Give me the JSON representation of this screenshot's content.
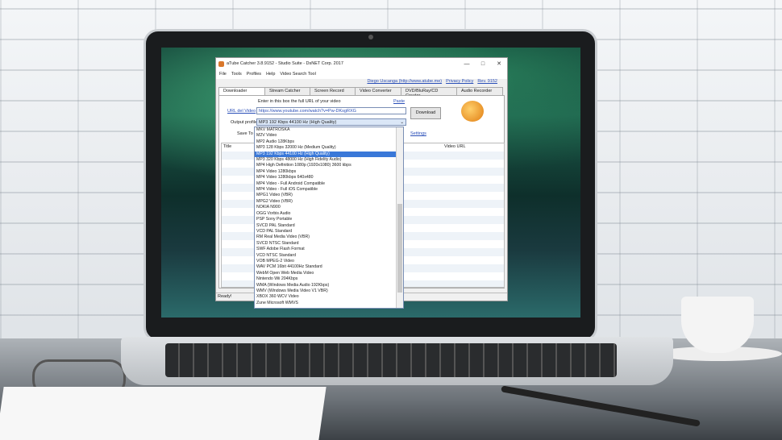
{
  "window": {
    "title": "aTube Catcher 3.8.9152 - Studio Suite - DsNET Corp. 2017",
    "minimize": "—",
    "maximize": "□",
    "close": "✕"
  },
  "menu": [
    "File",
    "Tools",
    "Profiles",
    "Help",
    "Video Search Tool"
  ],
  "header_links": {
    "email": "Diego Uscanga (http://www.atube.me)",
    "privacy": "Privacy Policy",
    "rev": "Rev. 9152"
  },
  "tabs": [
    "Downloader",
    "Stream Catcher",
    "Screen Record",
    "Video Converter",
    "DVD/BluRay/CD Creator",
    "Audio Recorder"
  ],
  "downloader": {
    "hint": "Enter in this box the full URL of your video",
    "paste": "Paste",
    "url_label": "URL del Video",
    "url_value": "https://www.youtube.com/watch?v=Pw-DKsgRXG",
    "profile_label": "Output profile",
    "profile_value": "MP3 192 Kbps 44100 Hz (High Quality)",
    "save_label": "Save To",
    "settings": "Settings",
    "download": "Download",
    "col_title": "Title",
    "col_url": "Video URL"
  },
  "status": "Ready!",
  "dropdown": {
    "selected_index": 4,
    "options": [
      "MKV MATROSKA",
      "M2V Video",
      "MP2 Audio 128Kbps",
      "MP3 128 Kbps 32000 Hz (Medium Quality)",
      "MP3 192 Kbps 44100 Hz (High Quality)",
      "MP3 320 Kbps 48000 Hz (High Fidelity Audio)",
      "MP4 High Definition 1080p (1920x1080) 3600 kbps",
      "MP4 Video 1280kbps",
      "MP4 Video 1280kbps 640x480",
      "MP4 Video - Full Android Compatible",
      "MP4 Video - Full iOS Compatible",
      "MPG1 Video (VBR)",
      "MPG2 Video (VBR)",
      "NOKIA N900",
      "OGG Vorbis Audio",
      "PSP Sony Portable",
      "SVCD PAL Standard",
      "VCD PAL Standard",
      "RM Real Media Video (VBR)",
      "SVCD NTSC Standard",
      "SWF Adobe Flash Format",
      "VCD NTSC Standard",
      "VOB MPEG-2 Video",
      "WAV PCM 16bit 44100Hz Standard",
      "WebM Open Web Media Video",
      "Nintendo Wii 204Kbps",
      "WMA (Windows Media Audio 192Kbps)",
      "WMV (Windows Media Video V1 VBR)",
      "XBOX 360 WCV Video",
      "Zune Microsoft WMVS"
    ]
  }
}
